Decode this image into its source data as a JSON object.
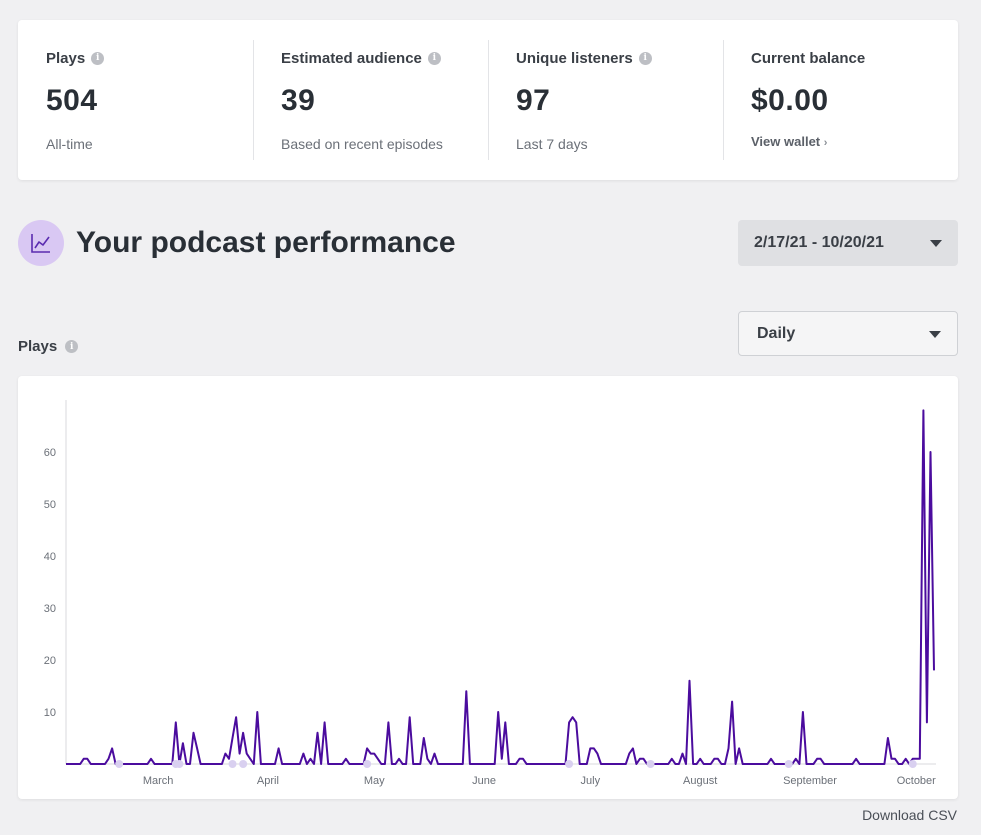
{
  "stats": [
    {
      "label": "Plays",
      "info": true,
      "value": "504",
      "sub": "All-time"
    },
    {
      "label": "Estimated audience",
      "info": true,
      "value": "39",
      "sub": "Based on recent episodes"
    },
    {
      "label": "Unique listeners",
      "info": true,
      "value": "97",
      "sub": "Last 7 days"
    },
    {
      "label": "Current balance",
      "info": false,
      "value": "$0.00",
      "link": "View wallet"
    }
  ],
  "section": {
    "title": "Your podcast performance",
    "icon": "trend-chart-icon"
  },
  "date_range": {
    "value": "2/17/21 - 10/20/21"
  },
  "plays_label": "Plays",
  "period": {
    "value": "Daily"
  },
  "download_label": "Download CSV",
  "colors": {
    "line": "#4b0c9e",
    "marker": "#d9d0f0",
    "accent_bg": "#d9c8f3"
  },
  "chart_data": {
    "type": "line",
    "x_range": [
      "2021-02-17",
      "2021-10-20"
    ],
    "ylim": [
      0,
      70
    ],
    "yticks": [
      10,
      20,
      30,
      40,
      50,
      60
    ],
    "xticks": [
      "March",
      "April",
      "May",
      "June",
      "July",
      "August",
      "September",
      "October"
    ],
    "grid": false,
    "series": [
      {
        "points": [
          [
            "2021-02-17",
            0
          ],
          [
            "2021-02-21",
            0
          ],
          [
            "2021-02-22",
            1
          ],
          [
            "2021-02-23",
            1
          ],
          [
            "2021-02-24",
            0
          ],
          [
            "2021-02-28",
            0
          ],
          [
            "2021-03-01",
            1
          ],
          [
            "2021-03-02",
            3
          ],
          [
            "2021-03-03",
            0
          ],
          [
            "2021-03-12",
            0
          ],
          [
            "2021-03-13",
            1
          ],
          [
            "2021-03-14",
            0
          ],
          [
            "2021-03-19",
            0
          ],
          [
            "2021-03-20",
            8
          ],
          [
            "2021-03-21",
            0
          ],
          [
            "2021-03-22",
            4
          ],
          [
            "2021-03-23",
            0
          ],
          [
            "2021-03-24",
            0
          ],
          [
            "2021-03-25",
            6
          ],
          [
            "2021-03-26",
            3
          ],
          [
            "2021-03-27",
            0
          ],
          [
            "2021-04-02",
            0
          ],
          [
            "2021-04-03",
            2
          ],
          [
            "2021-04-04",
            1
          ],
          [
            "2021-04-05",
            5
          ],
          [
            "2021-04-06",
            9
          ],
          [
            "2021-04-07",
            2
          ],
          [
            "2021-04-08",
            6
          ],
          [
            "2021-04-09",
            2
          ],
          [
            "2021-04-10",
            1
          ],
          [
            "2021-04-11",
            0
          ],
          [
            "2021-04-12",
            10
          ],
          [
            "2021-04-13",
            0
          ],
          [
            "2021-04-17",
            0
          ],
          [
            "2021-04-18",
            3
          ],
          [
            "2021-04-19",
            0
          ],
          [
            "2021-04-24",
            0
          ],
          [
            "2021-04-25",
            2
          ],
          [
            "2021-04-26",
            0
          ],
          [
            "2021-04-27",
            1
          ],
          [
            "2021-04-28",
            0
          ],
          [
            "2021-04-29",
            6
          ],
          [
            "2021-04-30",
            0
          ],
          [
            "2021-05-01",
            8
          ],
          [
            "2021-05-02",
            0
          ],
          [
            "2021-05-06",
            0
          ],
          [
            "2021-05-07",
            1
          ],
          [
            "2021-05-08",
            0
          ],
          [
            "2021-05-12",
            0
          ],
          [
            "2021-05-13",
            3
          ],
          [
            "2021-05-14",
            2
          ],
          [
            "2021-05-15",
            2
          ],
          [
            "2021-05-16",
            1
          ],
          [
            "2021-05-17",
            0
          ],
          [
            "2021-05-18",
            0
          ],
          [
            "2021-05-19",
            8
          ],
          [
            "2021-05-20",
            0
          ],
          [
            "2021-05-21",
            0
          ],
          [
            "2021-05-22",
            1
          ],
          [
            "2021-05-23",
            0
          ],
          [
            "2021-05-24",
            0
          ],
          [
            "2021-05-25",
            9
          ],
          [
            "2021-05-26",
            0
          ],
          [
            "2021-05-27",
            0
          ],
          [
            "2021-05-28",
            0
          ],
          [
            "2021-05-29",
            5
          ],
          [
            "2021-05-30",
            1
          ],
          [
            "2021-05-31",
            0
          ],
          [
            "2021-06-01",
            2
          ],
          [
            "2021-06-02",
            0
          ],
          [
            "2021-06-09",
            0
          ],
          [
            "2021-06-10",
            14
          ],
          [
            "2021-06-11",
            0
          ],
          [
            "2021-06-18",
            0
          ],
          [
            "2021-06-19",
            10
          ],
          [
            "2021-06-20",
            1
          ],
          [
            "2021-06-21",
            8
          ],
          [
            "2021-06-22",
            0
          ],
          [
            "2021-06-23",
            0
          ],
          [
            "2021-06-24",
            0
          ],
          [
            "2021-06-25",
            1
          ],
          [
            "2021-06-26",
            1
          ],
          [
            "2021-06-27",
            0
          ],
          [
            "2021-07-04",
            0
          ],
          [
            "2021-07-08",
            0
          ],
          [
            "2021-07-09",
            8
          ],
          [
            "2021-07-10",
            9
          ],
          [
            "2021-07-11",
            8
          ],
          [
            "2021-07-12",
            0
          ],
          [
            "2021-07-14",
            0
          ],
          [
            "2021-07-15",
            3
          ],
          [
            "2021-07-16",
            3
          ],
          [
            "2021-07-17",
            2
          ],
          [
            "2021-07-18",
            0
          ],
          [
            "2021-07-25",
            0
          ],
          [
            "2021-07-26",
            2
          ],
          [
            "2021-07-27",
            3
          ],
          [
            "2021-07-28",
            0
          ],
          [
            "2021-07-29",
            1
          ],
          [
            "2021-07-30",
            1
          ],
          [
            "2021-07-31",
            0
          ],
          [
            "2021-08-06",
            0
          ],
          [
            "2021-08-07",
            1
          ],
          [
            "2021-08-08",
            0
          ],
          [
            "2021-08-09",
            0
          ],
          [
            "2021-08-10",
            2
          ],
          [
            "2021-08-11",
            0
          ],
          [
            "2021-08-12",
            16
          ],
          [
            "2021-08-13",
            0
          ],
          [
            "2021-08-14",
            0
          ],
          [
            "2021-08-15",
            1
          ],
          [
            "2021-08-16",
            0
          ],
          [
            "2021-08-18",
            0
          ],
          [
            "2021-08-19",
            1
          ],
          [
            "2021-08-20",
            1
          ],
          [
            "2021-08-21",
            0
          ],
          [
            "2021-08-22",
            0
          ],
          [
            "2021-08-23",
            3
          ],
          [
            "2021-08-24",
            12
          ],
          [
            "2021-08-25",
            0
          ],
          [
            "2021-08-26",
            3
          ],
          [
            "2021-08-27",
            0
          ],
          [
            "2021-09-03",
            0
          ],
          [
            "2021-09-04",
            1
          ],
          [
            "2021-09-05",
            0
          ],
          [
            "2021-09-10",
            0
          ],
          [
            "2021-09-11",
            1
          ],
          [
            "2021-09-12",
            0
          ],
          [
            "2021-09-13",
            10
          ],
          [
            "2021-09-14",
            0
          ],
          [
            "2021-09-16",
            0
          ],
          [
            "2021-09-17",
            1
          ],
          [
            "2021-09-18",
            1
          ],
          [
            "2021-09-19",
            0
          ],
          [
            "2021-09-27",
            0
          ],
          [
            "2021-09-28",
            1
          ],
          [
            "2021-09-29",
            0
          ],
          [
            "2021-10-06",
            0
          ],
          [
            "2021-10-07",
            5
          ],
          [
            "2021-10-08",
            1
          ],
          [
            "2021-10-09",
            1
          ],
          [
            "2021-10-10",
            0
          ],
          [
            "2021-10-11",
            0
          ],
          [
            "2021-10-12",
            1
          ],
          [
            "2021-10-13",
            0
          ],
          [
            "2021-10-14",
            1
          ],
          [
            "2021-10-15",
            1
          ],
          [
            "2021-10-16",
            1
          ],
          [
            "2021-10-17",
            68
          ],
          [
            "2021-10-18",
            8
          ],
          [
            "2021-10-19",
            60
          ],
          [
            "2021-10-20",
            18
          ]
        ]
      }
    ],
    "markers": [
      "2021-03-04",
      "2021-03-20",
      "2021-03-21",
      "2021-04-05",
      "2021-04-08",
      "2021-05-13",
      "2021-07-09",
      "2021-08-01",
      "2021-09-09",
      "2021-10-14"
    ]
  }
}
